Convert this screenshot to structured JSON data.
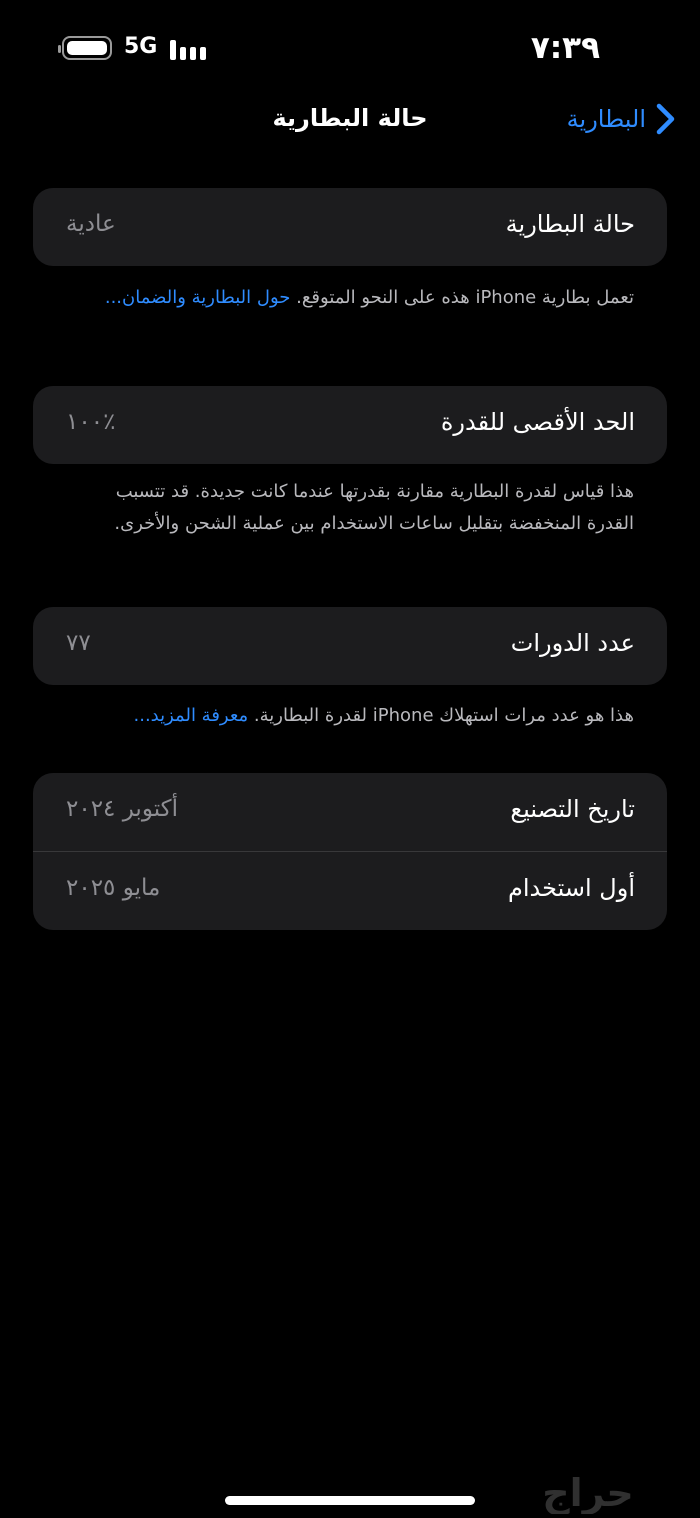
{
  "status_bar": {
    "time": "٧:٣٩",
    "network": "5G",
    "battery_level": 1.0,
    "battery_icon": "battery-icon",
    "signal_icon": "cellular-signal-icon"
  },
  "nav": {
    "title": "حالة البطارية",
    "back_label": "البطارية",
    "back_icon": "chevron-back-icon",
    "accent": "#2f8cff"
  },
  "health": {
    "label": "حالة البطارية",
    "value": "عادية",
    "footer_text": "تعمل بطارية iPhone هذه على النحو المتوقع.",
    "footer_link": "حول البطارية والضمان..."
  },
  "capacity": {
    "label": "الحد الأقصى للقدرة",
    "value": "٪١٠٠",
    "footer_text": "هذا قياس لقدرة البطارية مقارنة بقدرتها عندما كانت جديدة. قد تتسبب القدرة المنخفضة بتقليل ساعات الاستخدام بين عملية الشحن والأخرى."
  },
  "cycles": {
    "label": "عدد الدورات",
    "value": "٧٧",
    "footer_text": "هذا هو عدد مرات استهلاك iPhone لقدرة البطارية.",
    "footer_link": "معرفة المزيد..."
  },
  "dates": {
    "manufacture_label": "تاريخ التصنيع",
    "manufacture_value": "أكتوبر ٢٠٢٤",
    "first_use_label": "أول استخدام",
    "first_use_value": "مايو ٢٠٢٥"
  },
  "watermark": "حراج"
}
